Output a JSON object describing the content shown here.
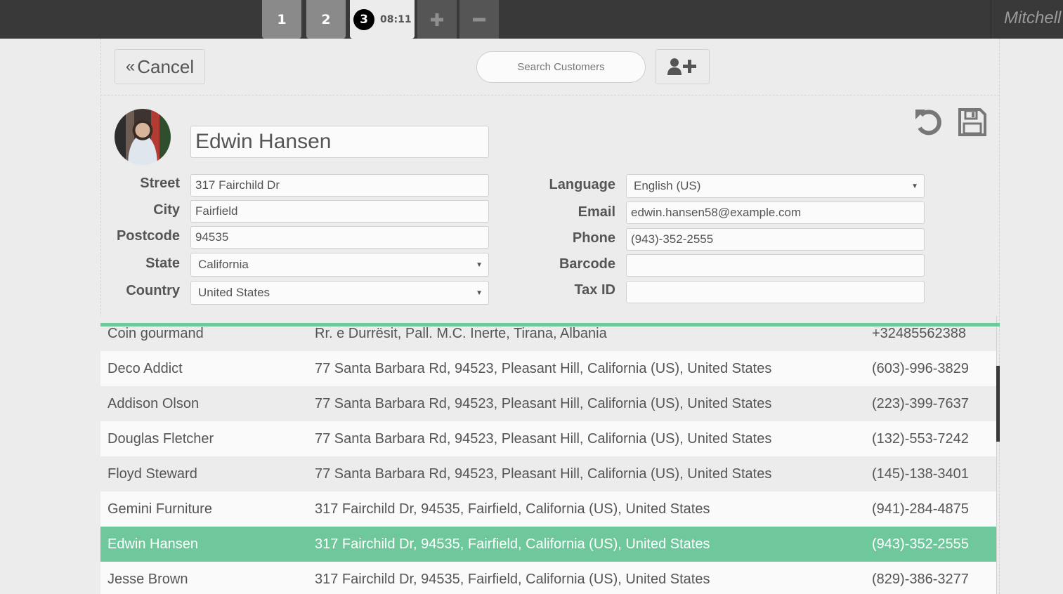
{
  "topbar": {
    "order_tabs": [
      {
        "label": "1"
      },
      {
        "label": "2"
      },
      {
        "label": "3",
        "time": "08:11",
        "active": true
      }
    ],
    "add_order_icon": "plus-icon",
    "remove_order_icon": "minus-icon",
    "user_name": "Mitchell"
  },
  "header": {
    "cancel_label": "Cancel",
    "cancel_icon": "double-chevron-left-icon",
    "search_placeholder": "Search Customers",
    "add_customer_icon": "user-plus-icon"
  },
  "client": {
    "name": "Edwin Hansen",
    "avatar_icon": "avatar-photo",
    "undo_icon": "undo-icon",
    "save_icon": "floppy-disk-icon",
    "left_fields": [
      {
        "label": "Street",
        "value": "317 Fairchild Dr",
        "type": "text"
      },
      {
        "label": "City",
        "value": "Fairfield",
        "type": "text"
      },
      {
        "label": "Postcode",
        "value": "94535",
        "type": "text"
      },
      {
        "label": "State",
        "value": "California",
        "type": "select"
      },
      {
        "label": "Country",
        "value": "United States",
        "type": "select"
      }
    ],
    "right_fields": [
      {
        "label": "Language",
        "value": "English (US)",
        "type": "select"
      },
      {
        "label": "Email",
        "value": "edwin.hansen58@example.com",
        "type": "text"
      },
      {
        "label": "Phone",
        "value": "(943)-352-2555",
        "type": "text"
      },
      {
        "label": "Barcode",
        "value": "",
        "type": "text"
      },
      {
        "label": "Tax ID",
        "value": "",
        "type": "text"
      }
    ]
  },
  "customers": [
    {
      "name": "Coin gourmand",
      "address": "Rr. e Durrësit, Pall. M.C. Inerte, Tirana, Albania",
      "phone": "+32485562388"
    },
    {
      "name": "Deco Addict",
      "address": "77 Santa Barbara Rd, 94523, Pleasant Hill, California (US), United States",
      "phone": "(603)-996-3829"
    },
    {
      "name": "Addison Olson",
      "address": "77 Santa Barbara Rd, 94523, Pleasant Hill, California (US), United States",
      "phone": "(223)-399-7637"
    },
    {
      "name": "Douglas Fletcher",
      "address": "77 Santa Barbara Rd, 94523, Pleasant Hill, California (US), United States",
      "phone": "(132)-553-7242"
    },
    {
      "name": "Floyd Steward",
      "address": "77 Santa Barbara Rd, 94523, Pleasant Hill, California (US), United States",
      "phone": "(145)-138-3401"
    },
    {
      "name": "Gemini Furniture",
      "address": "317 Fairchild Dr, 94535, Fairfield, California (US), United States",
      "phone": "(941)-284-4875"
    },
    {
      "name": "Edwin Hansen",
      "address": "317 Fairchild Dr, 94535, Fairfield, California (US), United States",
      "phone": "(943)-352-2555",
      "selected": true
    },
    {
      "name": "Jesse Brown",
      "address": "317 Fairchild Dr, 94535, Fairfield, California (US), United States",
      "phone": "(829)-386-3277"
    }
  ],
  "colors": {
    "accent": "#6ec89b",
    "topbar": "#393939",
    "background": "#ececec"
  }
}
